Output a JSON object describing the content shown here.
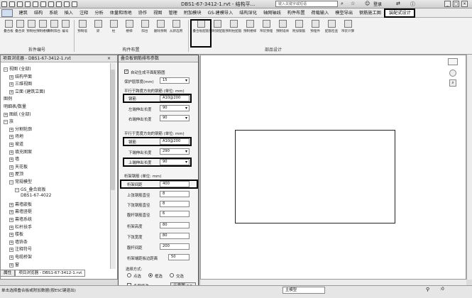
{
  "app": {
    "title": "DBS1-67-3412-1.rvt - 结构平...",
    "search_placeholder": "键入关键字或短语",
    "login": "登录"
  },
  "menu": {
    "tabs": [
      "建筑",
      "结构",
      "系统",
      "插入",
      "注释",
      "分析",
      "体量和场地",
      "协作",
      "视图",
      "管理",
      "附加模块",
      "GS-建模导入",
      "结构深化",
      "轴网轴线",
      "构件布置",
      "荷载输入",
      "模型导出",
      "钢筋施工图",
      "装配式设计"
    ],
    "active": "装配式设计"
  },
  "ribbon": {
    "group1_buttons": [
      "叠合板",
      "叠合梁",
      "预制柱",
      "预制楼梯",
      "预制阳台",
      "编号"
    ],
    "group2_buttons": [
      "预制墙",
      "梁",
      "柱",
      "楼梯",
      "阳台",
      "删除预制",
      "从新选用"
    ],
    "group3_buttons": [
      "叠合板配筋",
      "预制梁配筋",
      "预制柱配筋",
      "预制楼梯",
      "吊装预埋",
      "预制墙体",
      "附加钢筋",
      "预埋件",
      "配筋检查",
      "吊装计算"
    ],
    "groups": [
      "拆件编号",
      "构件布置",
      "部品设计"
    ]
  },
  "project_browser": {
    "title": "项目浏览器 - DBS1-67-3412-1.rvt",
    "items": [
      {
        "label": "视图 (全部)",
        "level": 0,
        "exp": "−"
      },
      {
        "label": "结构平面",
        "level": 1,
        "exp": "+"
      },
      {
        "label": "三维视图",
        "level": 1,
        "exp": "+"
      },
      {
        "label": "立面 (建筑立面)",
        "level": 1,
        "exp": "+"
      },
      {
        "label": "图例",
        "level": 0,
        "exp": ""
      },
      {
        "label": "明细表/数量",
        "level": 0,
        "exp": ""
      },
      {
        "label": "图纸 (全部)",
        "level": 0,
        "exp": "+"
      },
      {
        "label": "族",
        "level": 0,
        "exp": "−"
      },
      {
        "label": "分割轮廓",
        "level": 1,
        "exp": "+"
      },
      {
        "label": "场地",
        "level": 1,
        "exp": "+"
      },
      {
        "label": "坡道",
        "level": 1,
        "exp": "+"
      },
      {
        "label": "填充图案",
        "level": 1,
        "exp": "+"
      },
      {
        "label": "墙",
        "level": 1,
        "exp": "+"
      },
      {
        "label": "天花板",
        "level": 1,
        "exp": "+"
      },
      {
        "label": "屋顶",
        "level": 1,
        "exp": "+"
      },
      {
        "label": "常规模型",
        "level": 1,
        "exp": "−"
      },
      {
        "label": "GS_叠合底板",
        "level": 2,
        "exp": "−"
      },
      {
        "label": "DBS1-67-4022",
        "level": 3,
        "exp": ""
      },
      {
        "label": "幕墙嵌板",
        "level": 1,
        "exp": "+"
      },
      {
        "label": "幕墙竖梃",
        "level": 1,
        "exp": "+"
      },
      {
        "label": "幕墙系统",
        "level": 1,
        "exp": "+"
      },
      {
        "label": "栏杆扶手",
        "level": 1,
        "exp": "+"
      },
      {
        "label": "楼板",
        "level": 1,
        "exp": "+"
      },
      {
        "label": "墙饰条",
        "level": 1,
        "exp": "+"
      },
      {
        "label": "注释符号",
        "level": 1,
        "exp": "+"
      },
      {
        "label": "电缆桥架",
        "level": 1,
        "exp": "+"
      },
      {
        "label": "窗",
        "level": 1,
        "exp": "+"
      }
    ],
    "tabs": [
      "属性",
      "项目浏览器 - DBS1-67-3412-1.rvt"
    ]
  },
  "dialog": {
    "title": "叠合板钢筋排布参数",
    "auto_gen_label": "自动生成平面配筋图",
    "cover_label": "保护层厚度(mm)",
    "cover_value": "15",
    "sec_parallel": "平行于跨度方向的钢筋 (单位: mm)",
    "rebar_label": "钢筋",
    "rebar1_value": "A10@200",
    "left_ext_label": "左端伸出长度",
    "left_ext_value": "90",
    "right_ext_label": "右端伸出长度",
    "right_ext_value": "90",
    "sec_perp": "平行于宽度方向的钢筋 (单位: mm)",
    "rebar2_value": "A10@200",
    "bottom_ext_label": "下端伸出长度",
    "bottom_ext_value": "290",
    "top_ext_label": "上端伸出长度",
    "top_ext_value": "90",
    "sec_truss": "桁架钢筋 (单位: mm)",
    "truss_spacing_label": "桁架间距",
    "truss_spacing_value": "400",
    "top_chord_label": "上弦钢筋直径",
    "top_chord_value": "8",
    "bottom_chord_label": "下弦钢筋直径",
    "bottom_chord_value": "8",
    "web_label": "腹杆钢筋直径",
    "web_value": "6",
    "truss_height_label": "桁架高度",
    "truss_height_value": "80",
    "bottom_width_label": "下弦宽度",
    "bottom_width_value": "80",
    "web_span_label": "腹杆间距",
    "web_span_value": "200",
    "edge_dist_label": "桁架端距板边距离",
    "edge_dist_value": "50",
    "select_mode_label": "选择方式:",
    "mode_point": "点选",
    "mode_box": "框选",
    "mode_cross": "交选",
    "multilayer_label": "多层修改",
    "preview_label": "示意图 >>"
  },
  "statusbar": {
    "text": "单击选择叠合板或附加数据(按ESC键退出)",
    "model_select": "主模型"
  }
}
